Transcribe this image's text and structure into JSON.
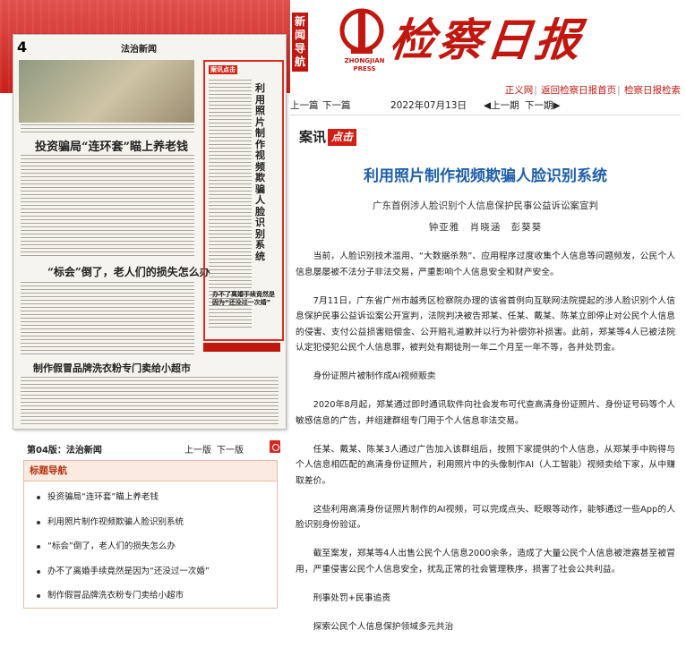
{
  "header": {
    "side_tag": "新闻导航",
    "masthead": "检察日报",
    "logo_sub": "ZHONGJIAN PRESS",
    "links": [
      "正义网",
      "返回检察日报首页",
      "检察日报检索"
    ]
  },
  "thumbnail": {
    "page_number": "4",
    "section": "法治新闻",
    "headline_main": "投资骗局“连环套”瞄上养老钱",
    "headline_second": "“标会”倒了，老人们的损失怎么办",
    "headline_third": "制作假冒品牌洗衣粉专门卖给小超市",
    "headline_side": "办不了离婚手续竟然是因为“还没过一次婚”",
    "framed_kicker": "案讯点击",
    "framed_title": "利用照片制作视频欺骗人脸识别系统"
  },
  "page_nav": {
    "page_label": "第04版：法治新闻",
    "prev": "上一版",
    "next": "下一版"
  },
  "titles_box": {
    "heading": "标题导航",
    "items": [
      "投资骗局“连环套”瞄上养老钱",
      "利用照片制作视频欺骗人脸识别系统",
      "“标会”倒了，老人们的损失怎么办",
      "办不了离婚手续竟然是因为“还没过一次婚”",
      "制作假冒品牌洗衣粉专门卖给小超市"
    ]
  },
  "article_nav": {
    "prev_article": "上一篇",
    "next_article": "下一篇",
    "date": "2022年07月13日",
    "prev_issue": "◀上一期",
    "next_issue": "下一期▶"
  },
  "article": {
    "kicker_1": "案讯",
    "kicker_2": "点击",
    "title": "利用照片制作视频欺骗人脸识别系统",
    "subtitle": "广东首例涉人脸识别个人信息保护民事公益诉讼案宣判",
    "authors": "钟亚雅　肖晓涵　彭葵葵",
    "paragraphs": [
      "当前，人脸识别技术滥用、“大数据杀熟”、应用程序过度收集个人信息等问题频发，公民个人信息屡屡被不法分子非法交易，严重影响个人信息安全和财产安全。",
      "7月11日，广东省广州市越秀区检察院办理的该省首例向互联网法院提起的涉人脸识别个人信息保护民事公益诉讼案公开宣判，法院判决被告郑某、任某、戴某、陈某立即停止对公民个人信息的侵害、支付公益损害赔偿金、公开赔礼道歉并以行为补偿弥补损害。此前，郑某等4人已被法院认定犯侵犯公民个人信息罪，被判处有期徒刑一年二个月至一年不等，各并处罚金。",
      "身份证照片被制作成AI视频贩卖",
      "2020年8月起，郑某通过即时通讯软件向社会发布可代查高清身份证照片、身份证号码等个人敏感信息的广告，并组建群组专门用于个人信息非法交易。",
      "任某、戴某、陈某3人通过广告加入该群组后，按照下家提供的个人信息，从郑某手中购得与个人信息相匹配的高清身份证照片，利用照片中的头像制作AI（人工智能）视频卖给下家，从中赚取差价。",
      "这些利用高清身份证照片制作的AI视频，可以完成点头、眨眼等动作，能够通过一些App的人脸识别身份验证。",
      "截至案发，郑某等4人出售公民个人信息2000余条，造成了大量公民个人信息被泄露甚至被冒用，严重侵害公民个人信息安全，扰乱正常的社会管理秩序，损害了社会公共利益。",
      "刑事处罚+民事追责",
      "探索公民个人信息保护领域多元共治"
    ]
  },
  "colors": {
    "brand_red": "#c0170f",
    "title_blue": "#1f5fa8",
    "nav_brown": "#b4320f"
  }
}
